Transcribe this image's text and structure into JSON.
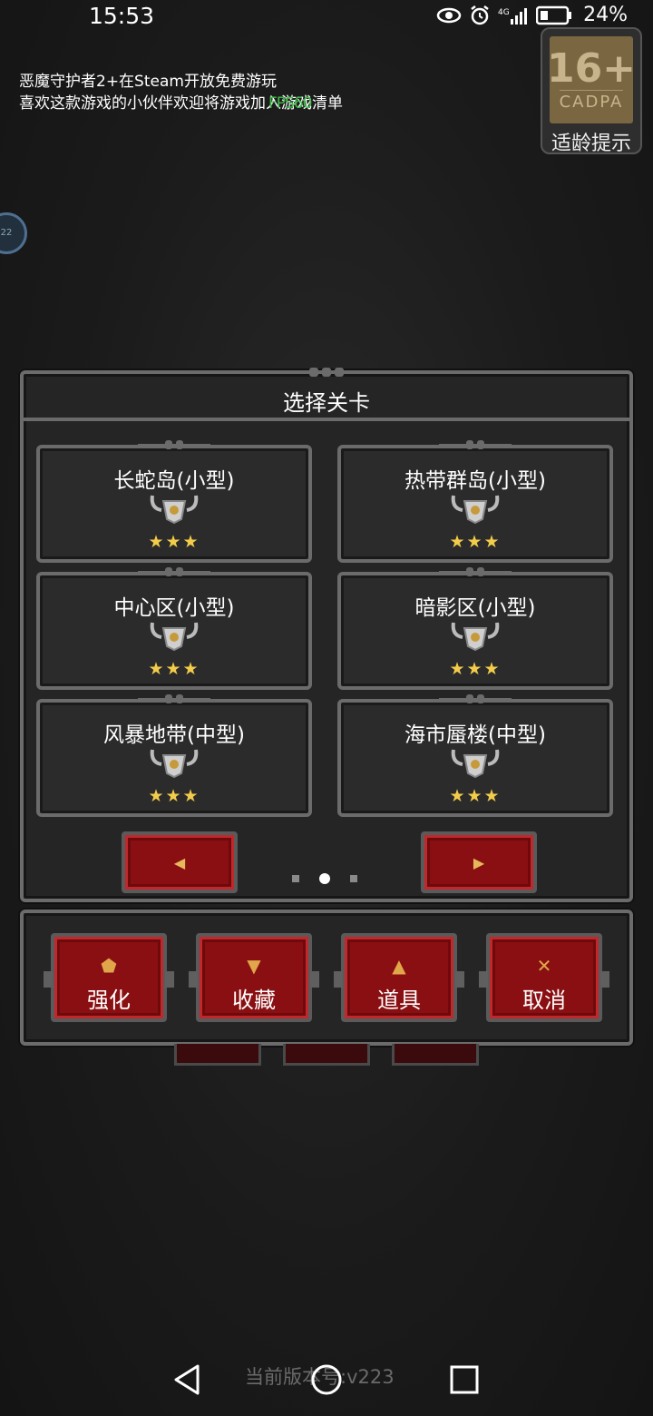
{
  "status_bar": {
    "time": "15:53",
    "battery": "24%"
  },
  "banner": {
    "line1": "恶魔守护者2+在Steam开放免费游玩",
    "line2": "喜欢这款游戏的小伙伴欢迎将游戏加入游戏清单",
    "fps": "FPS60"
  },
  "age_rating": {
    "rating": "16+",
    "org": "CADPA",
    "caption": "适龄提示"
  },
  "side_bubble": "22",
  "dialog": {
    "title": "选择关卡",
    "levels": [
      {
        "name": "长蛇岛(小型)",
        "stars": "★★★"
      },
      {
        "name": "热带群岛(小型)",
        "stars": "★★★"
      },
      {
        "name": "中心区(小型)",
        "stars": "★★★"
      },
      {
        "name": "暗影区(小型)",
        "stars": "★★★"
      },
      {
        "name": "风暴地带(中型)",
        "stars": "★★★"
      },
      {
        "name": "海市蜃楼(中型)",
        "stars": "★★★"
      }
    ],
    "prev_icon": "◀",
    "next_icon": "▶",
    "page": {
      "current": 2,
      "total": 3
    }
  },
  "actions": [
    {
      "label": "强化",
      "icon": "upgrade-icon",
      "glyph": "⬟"
    },
    {
      "label": "收藏",
      "icon": "trophy-icon",
      "glyph": "▼"
    },
    {
      "label": "道具",
      "icon": "potion-icon",
      "glyph": "▲"
    },
    {
      "label": "取消",
      "icon": "close-icon",
      "glyph": "✕"
    }
  ],
  "footer": {
    "version": "当前版本号:v223"
  },
  "colors": {
    "accent_red": "#8a0f12",
    "frame_gray": "#6b6b6b",
    "star_gold": "#f2cc4a",
    "fps_green": "#3fbf4a"
  }
}
